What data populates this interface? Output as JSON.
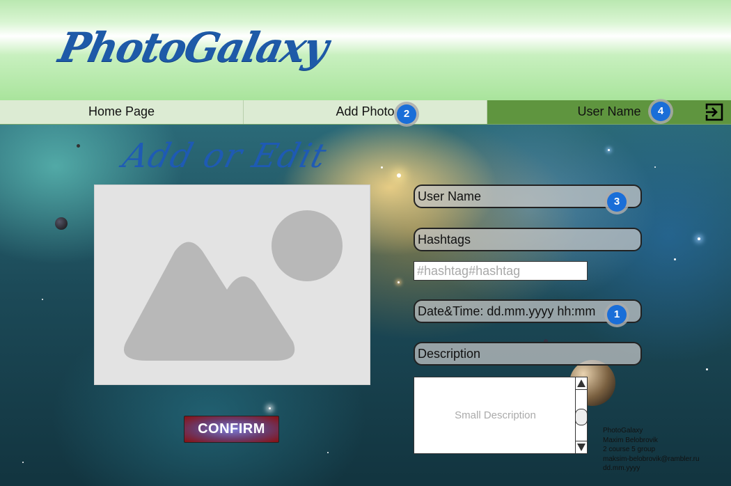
{
  "app": {
    "logo": "PhotoGalaxy"
  },
  "nav": {
    "home": "Home Page",
    "add_photo": "Add Photo",
    "user_name": "User Name"
  },
  "page": {
    "title": "Add or Edit"
  },
  "form": {
    "user_name_label": "User Name",
    "hashtags_label": "Hashtags",
    "hashtags_placeholder": "#hashtag#hashtag",
    "datetime_label": "Date&Time: dd.mm.yyyy  hh:mm",
    "description_label": "Description",
    "description_placeholder": "Small Description",
    "confirm": "CONFIRM"
  },
  "badges": {
    "add_photo": "2",
    "user_name_nav": "4",
    "user_field": "3",
    "datetime": "1"
  },
  "footer": {
    "line1": "PhotoGalaxy",
    "line2": "Maxim Belobrovik",
    "line3": "2 course 5 group",
    "line4": "maksim-belobrovik@rambler.ru",
    "line5": "dd.mm.yyyy"
  },
  "colors": {
    "accent_blue": "#1e5aa8",
    "nav_active": "#5f953f",
    "badge": "#1a6ed8",
    "confirm": "#8a1010"
  },
  "icons": {
    "logout": "logout-icon",
    "photo": "image-placeholder-icon",
    "scroll_up": "arrow-up-icon",
    "scroll_down": "arrow-down-icon"
  }
}
